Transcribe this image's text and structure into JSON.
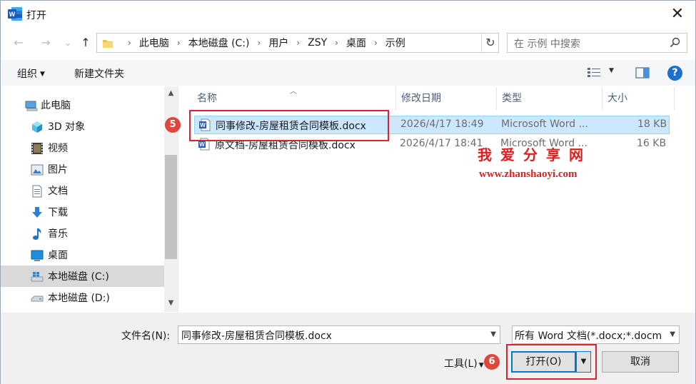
{
  "window": {
    "title": "打开",
    "close_glyph": "✕",
    "app_icon": "word-icon"
  },
  "nav": {
    "back": "←",
    "forward": "→",
    "recent": "⌄",
    "up": "↑"
  },
  "address": {
    "crumbs": [
      "此电脑",
      "本地磁盘 (C:)",
      "用户",
      "ZSY",
      "桌面",
      "示例"
    ],
    "separator": "›",
    "refresh_glyph": "↻"
  },
  "search": {
    "placeholder": "在 示例 中搜索"
  },
  "toolbar": {
    "organize": "组织",
    "new_folder": "新建文件夹",
    "help": "?"
  },
  "sidebar": {
    "items": [
      {
        "label": "此电脑",
        "icon": "computer-icon"
      },
      {
        "label": "3D 对象",
        "icon": "cube-icon"
      },
      {
        "label": "视频",
        "icon": "film-icon"
      },
      {
        "label": "图片",
        "icon": "picture-icon"
      },
      {
        "label": "文档",
        "icon": "document-icon"
      },
      {
        "label": "下载",
        "icon": "download-icon"
      },
      {
        "label": "音乐",
        "icon": "music-icon"
      },
      {
        "label": "桌面",
        "icon": "desktop-icon"
      },
      {
        "label": "本地磁盘 (C:)",
        "icon": "drive-windows-icon",
        "selected": true
      },
      {
        "label": "本地磁盘 (D:)",
        "icon": "drive-icon"
      }
    ]
  },
  "files": {
    "columns": [
      "名称",
      "修改日期",
      "类型",
      "大小"
    ],
    "rows": [
      {
        "name": "同事修改-房屋租赁合同模板.docx",
        "modified": "2026/4/17 18:49",
        "type": "Microsoft Word ...",
        "size": "18 KB",
        "selected": true
      },
      {
        "name": "原文档-房屋租赁合同模板.docx",
        "modified": "2026/4/17 18:41",
        "type": "Microsoft Word ...",
        "size": "16 KB",
        "selected": false
      }
    ]
  },
  "annotations": {
    "step5": "5",
    "step6": "6"
  },
  "watermark": {
    "line1": "我爱分享网",
    "line2": "www.zhanshaoyi.com"
  },
  "footer": {
    "filename_label": "文件名(N):",
    "filename_value": "同事修改-房屋租赁合同模板.docx",
    "filetype_value": "所有 Word 文档(*.docx;*.docm",
    "tools_label": "工具(L)",
    "open_label": "打开(O)",
    "cancel_label": "取消"
  },
  "colors": {
    "accent": "#0078d7",
    "selection": "#cce8ff",
    "callout": "#d9232e",
    "watermark": "#e11d1d"
  }
}
